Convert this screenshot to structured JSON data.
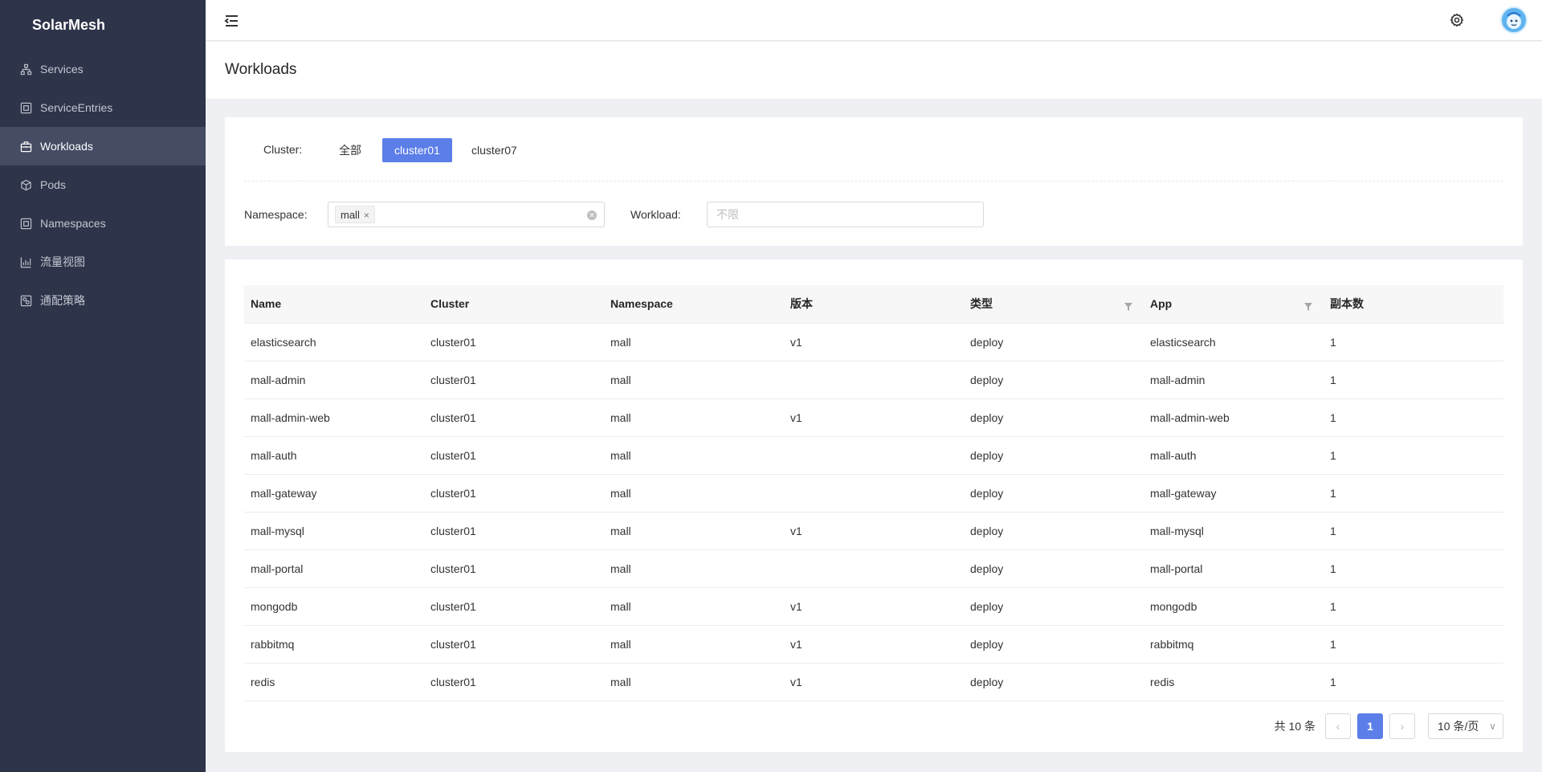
{
  "app": {
    "brand": "SolarMesh"
  },
  "sidebar": {
    "items": [
      {
        "label": "Services",
        "icon": "sitemap-icon",
        "active": false
      },
      {
        "label": "ServiceEntries",
        "icon": "entry-icon",
        "active": false
      },
      {
        "label": "Workloads",
        "icon": "briefcase-icon",
        "active": true
      },
      {
        "label": "Pods",
        "icon": "cube-icon",
        "active": false
      },
      {
        "label": "Namespaces",
        "icon": "namespace-icon",
        "active": false
      },
      {
        "label": "流量视图",
        "icon": "bar-chart-icon",
        "active": false
      },
      {
        "label": "通配策略",
        "icon": "policy-icon",
        "active": false
      }
    ]
  },
  "header": {
    "title": "Workloads"
  },
  "filters": {
    "cluster_label": "Cluster:",
    "cluster_options": [
      "全部",
      "cluster01",
      "cluster07"
    ],
    "cluster_selected": "cluster01",
    "namespace_label": "Namespace:",
    "namespace_tag": "mall",
    "namespace_tag_close": "×",
    "workload_label": "Workload:",
    "workload_placeholder": "不限"
  },
  "table": {
    "columns": [
      "Name",
      "Cluster",
      "Namespace",
      "版本",
      "类型",
      "App",
      "副本数"
    ],
    "rows": [
      [
        "elasticsearch",
        "cluster01",
        "mall",
        "v1",
        "deploy",
        "elasticsearch",
        "1"
      ],
      [
        "mall-admin",
        "cluster01",
        "mall",
        "",
        "deploy",
        "mall-admin",
        "1"
      ],
      [
        "mall-admin-web",
        "cluster01",
        "mall",
        "v1",
        "deploy",
        "mall-admin-web",
        "1"
      ],
      [
        "mall-auth",
        "cluster01",
        "mall",
        "",
        "deploy",
        "mall-auth",
        "1"
      ],
      [
        "mall-gateway",
        "cluster01",
        "mall",
        "",
        "deploy",
        "mall-gateway",
        "1"
      ],
      [
        "mall-mysql",
        "cluster01",
        "mall",
        "v1",
        "deploy",
        "mall-mysql",
        "1"
      ],
      [
        "mall-portal",
        "cluster01",
        "mall",
        "",
        "deploy",
        "mall-portal",
        "1"
      ],
      [
        "mongodb",
        "cluster01",
        "mall",
        "v1",
        "deploy",
        "mongodb",
        "1"
      ],
      [
        "rabbitmq",
        "cluster01",
        "mall",
        "v1",
        "deploy",
        "rabbitmq",
        "1"
      ],
      [
        "redis",
        "cluster01",
        "mall",
        "v1",
        "deploy",
        "redis",
        "1"
      ]
    ]
  },
  "pagination": {
    "total_text": "共 10 条",
    "prev": "‹",
    "next": "›",
    "current_page": "1",
    "page_size": "10 条/页",
    "page_size_chevron": "∨"
  },
  "colors": {
    "sidebar_bg": "#2e3449",
    "sidebar_active": "#454c63",
    "accent": "#5b7ee8"
  }
}
